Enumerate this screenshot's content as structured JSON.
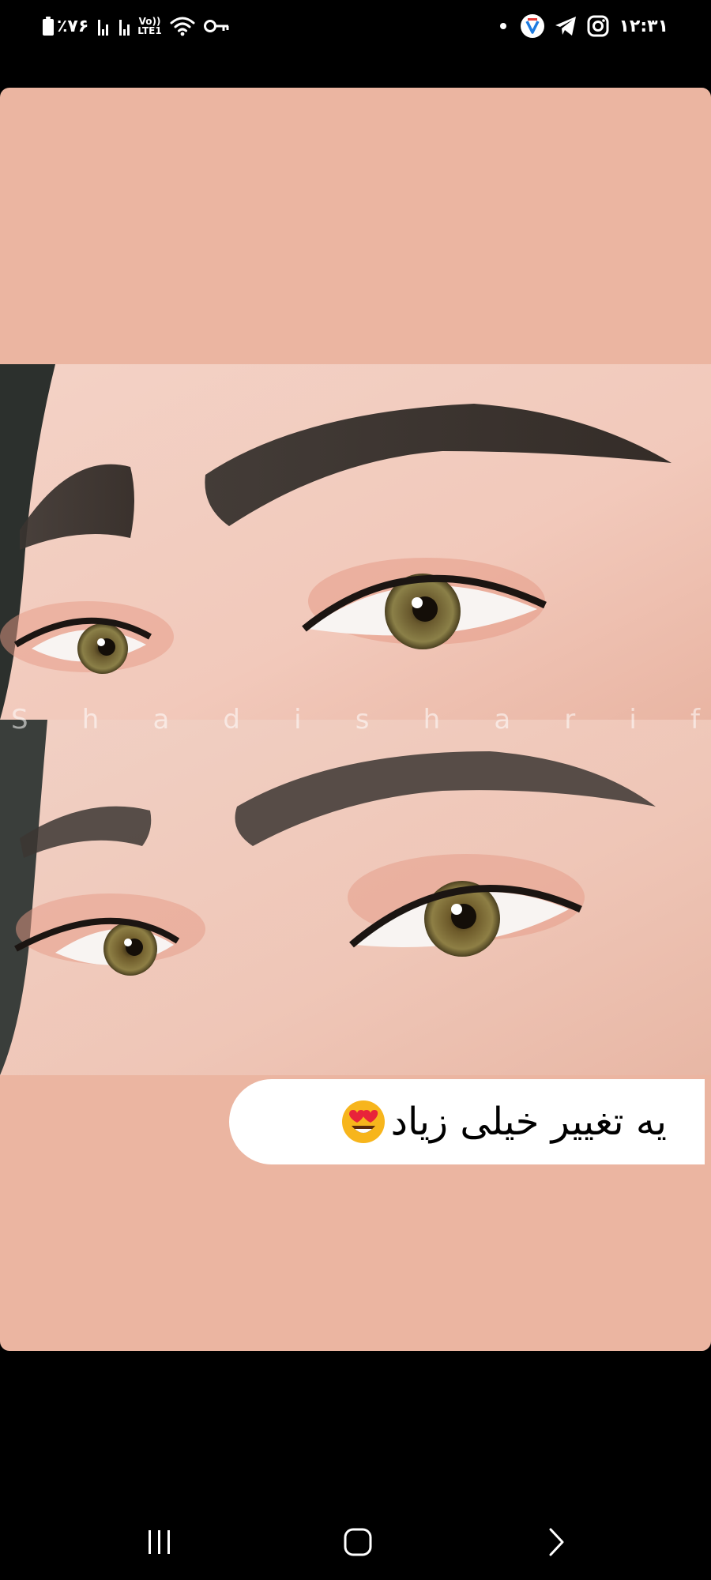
{
  "status_bar": {
    "battery_text": "٪۷۶",
    "volte_line1": "Vo))",
    "volte_line2": "LTE1",
    "time": "۱۲:۳۱"
  },
  "post": {
    "watermark_letters": [
      "S",
      "h",
      "a",
      "d",
      "i",
      "s",
      "h",
      "a",
      "r",
      "i",
      "f"
    ],
    "caption": "یه تغییر خیلی زیاد"
  },
  "colors": {
    "card_background": "#ebb5a1",
    "bubble_background": "#ffffff",
    "caption_text": "#000000"
  },
  "icons": {
    "status_left": [
      "battery-icon",
      "signal-icon",
      "signal-icon",
      "volte-icon",
      "wifi-icon",
      "key-icon"
    ],
    "status_right": [
      "dot-icon",
      "vpn-icon",
      "telegram-icon",
      "instagram-icon"
    ],
    "caption_emoji": "heart-eyes-emoji-icon",
    "navigation": [
      "recent-apps-icon",
      "home-icon",
      "back-icon"
    ]
  }
}
